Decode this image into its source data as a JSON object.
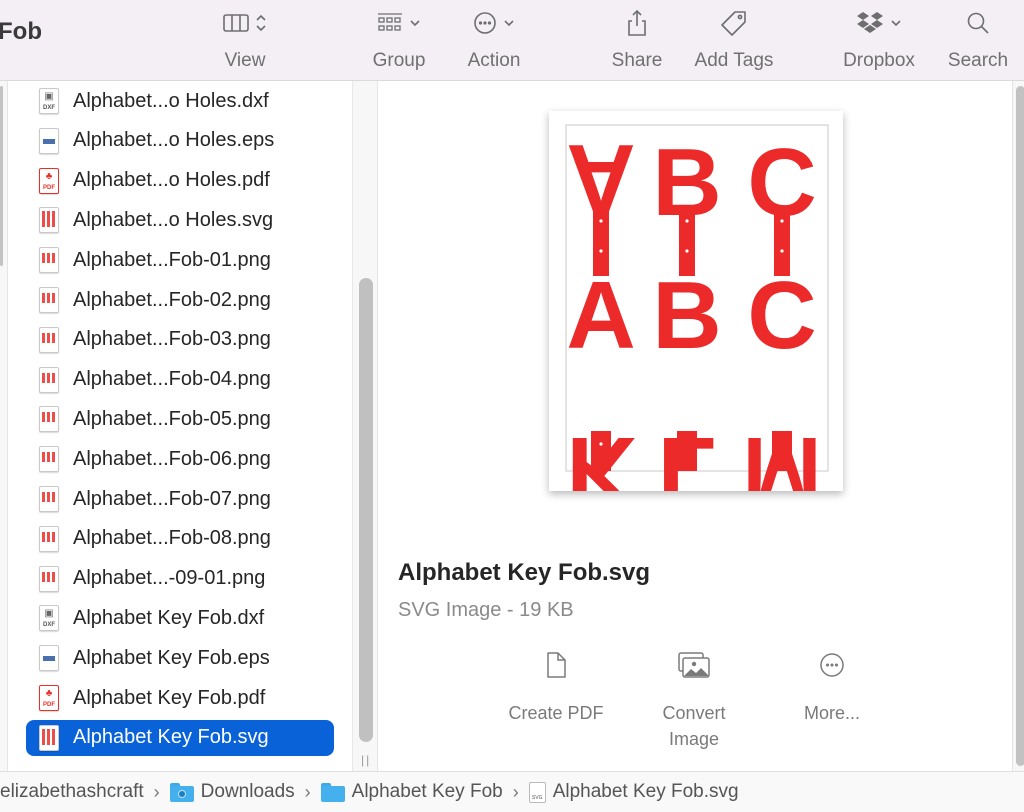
{
  "window": {
    "title": "Fob"
  },
  "toolbar": {
    "items": [
      {
        "id": "view",
        "label": "View",
        "icon": "column-view-icon"
      },
      {
        "id": "group",
        "label": "Group",
        "icon": "group-icon"
      },
      {
        "id": "action",
        "label": "Action",
        "icon": "ellipsis-circle-icon"
      },
      {
        "id": "share",
        "label": "Share",
        "icon": "share-icon"
      },
      {
        "id": "tags",
        "label": "Add Tags",
        "icon": "tag-icon"
      },
      {
        "id": "dropbox",
        "label": "Dropbox",
        "icon": "dropbox-icon"
      },
      {
        "id": "search",
        "label": "Search",
        "icon": "search-icon"
      }
    ]
  },
  "files": [
    {
      "name": "Alphabet...o Holes.dxf",
      "type": "dxf"
    },
    {
      "name": "Alphabet...o Holes.eps",
      "type": "eps"
    },
    {
      "name": "Alphabet...o Holes.pdf",
      "type": "pdf"
    },
    {
      "name": "Alphabet...o Holes.svg",
      "type": "svg"
    },
    {
      "name": "Alphabet...Fob-01.png",
      "type": "png"
    },
    {
      "name": "Alphabet...Fob-02.png",
      "type": "png"
    },
    {
      "name": "Alphabet...Fob-03.png",
      "type": "png"
    },
    {
      "name": "Alphabet...Fob-04.png",
      "type": "png"
    },
    {
      "name": "Alphabet...Fob-05.png",
      "type": "png"
    },
    {
      "name": "Alphabet...Fob-06.png",
      "type": "png"
    },
    {
      "name": "Alphabet...Fob-07.png",
      "type": "png"
    },
    {
      "name": "Alphabet...Fob-08.png",
      "type": "png"
    },
    {
      "name": "Alphabet...-09-01.png",
      "type": "png"
    },
    {
      "name": "Alphabet Key Fob.dxf",
      "type": "dxf"
    },
    {
      "name": "Alphabet Key Fob.eps",
      "type": "eps"
    },
    {
      "name": "Alphabet Key Fob.pdf",
      "type": "pdf"
    },
    {
      "name": "Alphabet Key Fob.svg",
      "type": "svg",
      "selected": true
    }
  ],
  "file_type_tags": {
    "dxf": "DXF",
    "pdf": "PDF",
    "svg": "SVG"
  },
  "preview": {
    "letters_top": [
      "A",
      "B",
      "C"
    ],
    "letters_mid": [
      "A",
      "B",
      "C"
    ],
    "letters_bottom": [
      "K",
      "L",
      "M"
    ],
    "accent_color": "#ec2a2a",
    "file_name": "Alphabet Key Fob.svg",
    "file_info": "SVG Image - 19 KB"
  },
  "quick_actions": [
    {
      "label": "Create PDF",
      "icon": "document-icon"
    },
    {
      "label": "Convert Image",
      "icon": "photos-icon"
    },
    {
      "label": "More...",
      "icon": "ellipsis-circle-icon"
    }
  ],
  "pathbar": {
    "crumbs": [
      {
        "label": "elizabethashcraft",
        "icon": null
      },
      {
        "label": "Downloads",
        "icon": "downloads-folder-icon"
      },
      {
        "label": "Alphabet Key Fob",
        "icon": "folder-icon"
      },
      {
        "label": "Alphabet Key Fob.svg",
        "icon": "svg-file-icon"
      }
    ],
    "separator": "›"
  },
  "colors": {
    "selection": "#0a62d9",
    "toolbar_bg": "#f3eff5"
  }
}
